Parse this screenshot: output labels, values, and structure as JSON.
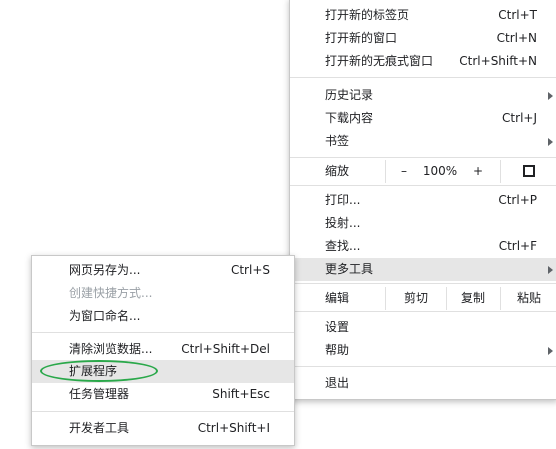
{
  "main_menu": {
    "items_top": [
      {
        "label": "打开新的标签页",
        "shortcut": "Ctrl+T"
      },
      {
        "label": "打开新的窗口",
        "shortcut": "Ctrl+N"
      },
      {
        "label": "打开新的无痕式窗口",
        "shortcut": "Ctrl+Shift+N"
      }
    ],
    "history": {
      "label": "历史记录"
    },
    "downloads": {
      "label": "下载内容",
      "shortcut": "Ctrl+J"
    },
    "bookmarks": {
      "label": "书签"
    },
    "zoom": {
      "label": "缩放",
      "minus": "–",
      "value": "100%",
      "plus": "+"
    },
    "print": {
      "label": "打印...",
      "shortcut": "Ctrl+P"
    },
    "cast": {
      "label": "投射..."
    },
    "find": {
      "label": "查找...",
      "shortcut": "Ctrl+F"
    },
    "more_tools": {
      "label": "更多工具"
    },
    "edit": {
      "label": "编辑",
      "cut": "剪切",
      "copy": "复制",
      "paste": "粘贴"
    },
    "settings": {
      "label": "设置"
    },
    "help": {
      "label": "帮助"
    },
    "exit": {
      "label": "退出"
    }
  },
  "sub_menu": {
    "save_page": {
      "label": "网页另存为...",
      "shortcut": "Ctrl+S"
    },
    "create_shortcut": {
      "label": "创建快捷方式..."
    },
    "name_window": {
      "label": "为窗口命名..."
    },
    "clear_data": {
      "label": "清除浏览数据...",
      "shortcut": "Ctrl+Shift+Del"
    },
    "extensions": {
      "label": "扩展程序"
    },
    "task_manager": {
      "label": "任务管理器",
      "shortcut": "Shift+Esc"
    },
    "dev_tools": {
      "label": "开发者工具",
      "shortcut": "Ctrl+Shift+I"
    }
  },
  "colors": {
    "highlight": "#e6e6e6",
    "annotation": "#2aa84a",
    "disabled": "#9aa0a6"
  }
}
